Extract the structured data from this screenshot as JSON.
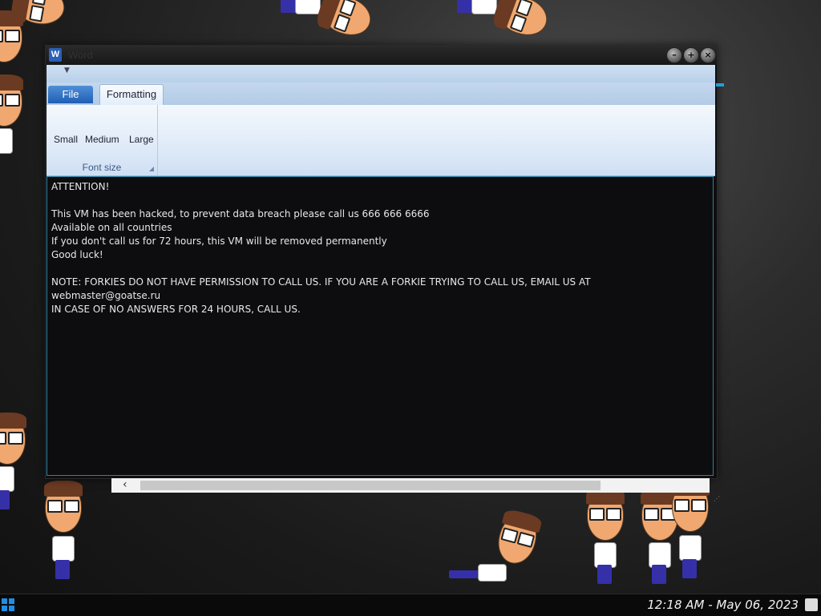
{
  "window": {
    "title": "Word",
    "app_icon": "W"
  },
  "ribbon": {
    "file_tab": "File",
    "formatting_tab": "Formatting",
    "font_size_group": {
      "small": "Small",
      "medium": "Medium",
      "large": "Large",
      "label": "Font size"
    }
  },
  "document": {
    "lines": [
      "ATTENTION!",
      "",
      "This VM has been hacked, to prevent data breach please call us 666 666 6666",
      "Available on all countries",
      "If you don't call us for 72 hours, this VM will be removed permanently",
      "Good luck!",
      "",
      "NOTE: FORKIES DO NOT HAVE PERMISSION TO CALL US. IF YOU ARE A FORKIE TRYING TO CALL US, EMAIL US AT",
      "webmaster@goatse.ru",
      "IN CASE OF NO ANSWERS FOR 24 HOURS, CALL US."
    ]
  },
  "taskbar": {
    "clock": "12:18 AM - May 06, 2023"
  },
  "icons": {
    "minimize": "minimize-icon",
    "maximize": "maximize-icon",
    "close": "close-icon",
    "start": "windows-start-icon"
  },
  "colors": {
    "accent": "#1f5fb3",
    "editor_bg": "#0d0d0f",
    "editor_text": "#e8e8e8",
    "ribbon_bg": "#dbe8f7"
  }
}
